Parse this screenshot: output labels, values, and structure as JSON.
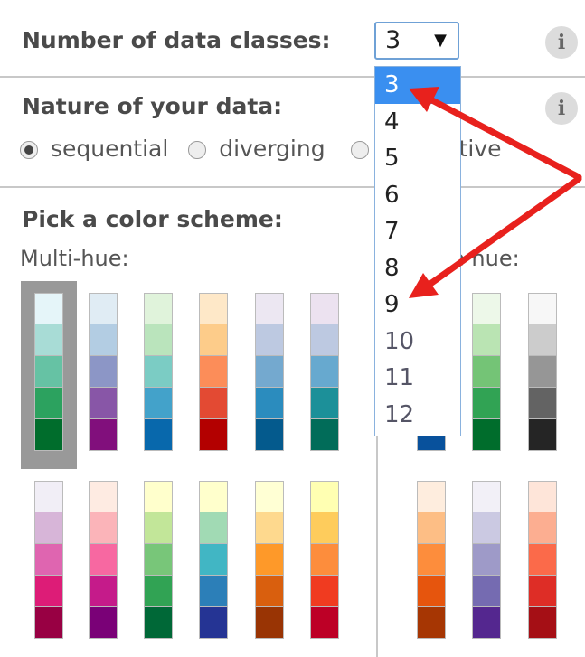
{
  "classes": {
    "label": "Number of data classes:",
    "selected": "3",
    "arrow": "▼",
    "options": [
      "3",
      "4",
      "5",
      "6",
      "7",
      "8",
      "9",
      "10",
      "11",
      "12"
    ]
  },
  "nature": {
    "label": "Nature of your data:",
    "options": [
      {
        "label": "sequential",
        "checked": true
      },
      {
        "label": "diverging",
        "checked": false
      },
      {
        "label": "qualitative",
        "checked": false
      }
    ]
  },
  "info_icon": "i",
  "scheme": {
    "label": "Pick a color scheme:",
    "multi_label": "Multi-hue:",
    "single_label": "Single hue:",
    "multi_row1": [
      [
        "#e5f5f9",
        "#99d8c9",
        "#2ca25f"
      ],
      [
        "#e0ecf4",
        "#9ebcda",
        "#8856a7"
      ],
      [
        "#e0f3db",
        "#a8ddb5",
        "#43a2ca"
      ],
      [
        "#fee8c8",
        "#fdbb84",
        "#e34a33"
      ],
      [
        "#ece7f2",
        "#a6bddb",
        "#2b8cbe"
      ],
      [
        "#ece2f0",
        "#a6bddb",
        "#1c9099"
      ]
    ],
    "multi_row1_shown": [
      [
        "#e5f5f9",
        "#a8dcd6",
        "#66c2a4",
        "#2ca25f",
        "#006d2c"
      ],
      [
        "#e0ecf4",
        "#b3cde3",
        "#8c96c6",
        "#8856a7",
        "#810f7c"
      ],
      [
        "#e0f3db",
        "#bae4bc",
        "#7bccc4",
        "#43a2ca",
        "#0868ac"
      ],
      [
        "#fee8c8",
        "#fdcc8a",
        "#fc8d59",
        "#e34a33",
        "#b30000"
      ],
      [
        "#ece7f2",
        "#bdc9e1",
        "#74a9cf",
        "#2b8cbe",
        "#045a8d"
      ],
      [
        "#ece2f0",
        "#bdc9e1",
        "#67a9cf",
        "#1c9099",
        "#016c59"
      ]
    ],
    "single_row1_shown": [
      [
        "#eff3ff",
        "#bdd7e7",
        "#6baed6",
        "#3182bd",
        "#08519c"
      ],
      [
        "#edf8e9",
        "#bae4b3",
        "#74c476",
        "#31a354",
        "#006d2c"
      ],
      [
        "#f7f7f7",
        "#cccccc",
        "#969696",
        "#636363",
        "#252525"
      ]
    ],
    "multi_row2_shown": [
      [
        "#f1eef6",
        "#d7b5d8",
        "#df65b0",
        "#dd1c77",
        "#980043"
      ],
      [
        "#feebe2",
        "#fbb4b9",
        "#f768a1",
        "#c51b8a",
        "#7a0177"
      ],
      [
        "#ffffcc",
        "#c2e699",
        "#78c679",
        "#31a354",
        "#006837"
      ],
      [
        "#ffffcc",
        "#a1dab4",
        "#41b6c4",
        "#2c7fb8",
        "#253494"
      ],
      [
        "#ffffd4",
        "#fed98e",
        "#fe9929",
        "#d95f0e",
        "#993404"
      ],
      [
        "#ffffb2",
        "#fecc5c",
        "#fd8d3c",
        "#f03b20",
        "#bd0026"
      ]
    ],
    "single_row2_shown": [
      [
        "#feedde",
        "#fdbe85",
        "#fd8d3c",
        "#e6550d",
        "#a63603"
      ],
      [
        "#f2f0f7",
        "#cbc9e2",
        "#9e9ac8",
        "#756bb1",
        "#54278f"
      ],
      [
        "#fee5d9",
        "#fcae91",
        "#fb6a4a",
        "#de2d26",
        "#a50f15"
      ]
    ]
  },
  "colors": {
    "dropdown_highlight": "#3a8ff0",
    "annotation_arrow": "#e8211d",
    "select_border": "#6fa1d6"
  }
}
